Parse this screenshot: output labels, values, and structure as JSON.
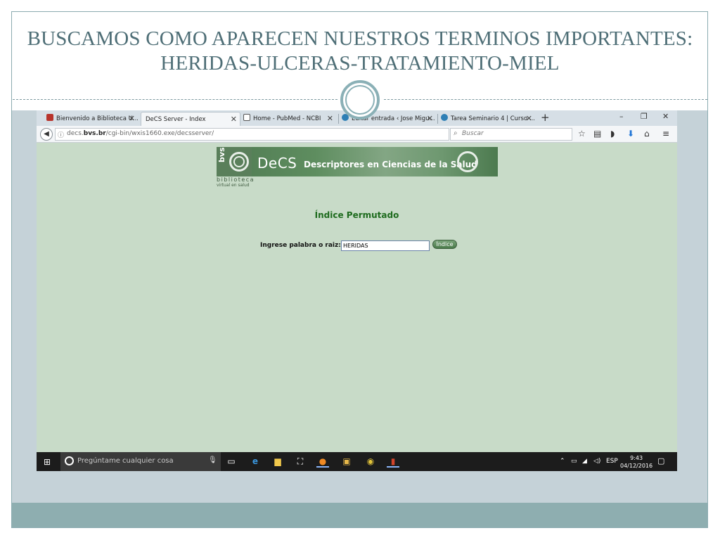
{
  "slide": {
    "title": "BUSCAMOS COMO APARECEN NUESTROS TERMINOS IMPORTANTES: HERIDAS-ULCERAS-TRATAMIENTO-MIEL"
  },
  "browser": {
    "tabs": [
      {
        "label": "Bienvenido a Biblioteca U...",
        "icon": "ucm-icon",
        "active": false
      },
      {
        "label": "DeCS Server - Index",
        "icon": "none",
        "active": true
      },
      {
        "label": "Home - PubMed - NCBI",
        "icon": "ncbi-icon",
        "active": false
      },
      {
        "label": "Editar entrada ‹ Jose Migu...",
        "icon": "wordpress-icon",
        "active": false
      },
      {
        "label": "Tarea Seminario 4 | Curso ...",
        "icon": "wordpress-icon",
        "active": false
      }
    ],
    "new_tab": "+",
    "window_controls": {
      "minimize": "–",
      "restore": "❐",
      "close": "✕"
    },
    "url_host_prefix": "decs.",
    "url_host_bold": "bvs.br",
    "url_path": "/cgi-bin/wxis1660.exe/decsserver/",
    "search_placeholder": "Buscar",
    "toolbar_icons": [
      "star-icon",
      "reading-list-icon",
      "pocket-icon",
      "download-icon",
      "home-icon",
      "menu-icon"
    ]
  },
  "page": {
    "banner_bvs": "bvs",
    "banner_decs": "DeCS",
    "banner_subtitle": "Descriptores en Ciencias de la Salud",
    "biblioteca": "biblioteca",
    "virtual": "virtual en salud",
    "heading": "Índice Permutado",
    "form_label": "Ingrese palabra o raiz:",
    "input_value": "HERIDAS",
    "button_label": "Índice"
  },
  "taskbar": {
    "search_text": "Pregúntame cualquier cosa",
    "apps": [
      "task-view-icon",
      "edge-icon",
      "file-explorer-icon",
      "store-icon",
      "firefox-icon",
      "mail-icon",
      "chrome-icon",
      "powerpoint-icon"
    ],
    "language": "ESP",
    "time": "9:43",
    "date": "04/12/2016"
  },
  "colors": {
    "page_bg": "#c8dbc8",
    "heading_green": "#1e6b1e",
    "slide_title": "#4e6e76",
    "slide_panel": "#c5d2d8",
    "slide_footer": "#8eaeb0"
  }
}
